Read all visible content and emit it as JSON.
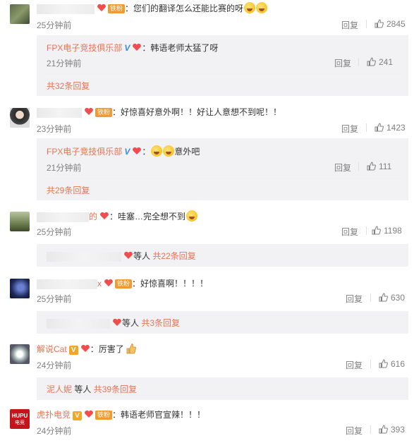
{
  "comments": [
    {
      "text": "：您们的翻译怎么还能比赛的呀",
      "badge": "铁粉",
      "time": "25分钟前",
      "reply_label": "回复",
      "likes": "2845",
      "sub_reply": {
        "name": "FPX电子竞技俱乐部",
        "text": "：韩语老师太猛了呀",
        "time": "21分钟前",
        "reply_label": "回复",
        "likes": "241"
      },
      "more": "共32条回复"
    },
    {
      "text": "：好惊喜好意外啊！！好让人意想不到呢！！",
      "badge": "铁粉",
      "time": "23分钟前",
      "reply_label": "回复",
      "likes": "1423",
      "sub_reply": {
        "name": "FPX电子竞技俱乐部",
        "text": "意外吧",
        "time": "21分钟前",
        "reply_label": "回复",
        "likes": "111"
      },
      "more": "共29条回复"
    },
    {
      "name_suffix": "的",
      "text": "：哇塞…完全想不到",
      "time": "25分钟前",
      "reply_label": "回复",
      "likes": "1198",
      "more_prefix": "等人",
      "more": "共22条回复"
    },
    {
      "name_suffix": "x",
      "badge": "铁粉",
      "text": "：好惊喜啊！！！！",
      "time": "25分钟前",
      "reply_label": "回复",
      "likes": "630",
      "more_prefix": "等人",
      "more": "共3条回复"
    },
    {
      "name": "解说Cat",
      "text": "：厉害了",
      "time": "24分钟前",
      "reply_label": "回复",
      "likes": "616",
      "more_name": "泥人妮",
      "more_prefix": "等人",
      "more": "共39条回复"
    },
    {
      "name": "虎扑电竞",
      "avatar_text": "HUPU",
      "avatar_sub": "电竞",
      "badge": "铁粉",
      "text": "：韩语老师官宣辣！！！",
      "time": "24分钟前",
      "reply_label": "回复",
      "likes": "393"
    }
  ],
  "colors": {
    "accent": "#eb7350",
    "link": "#eb7350",
    "muted": "#808080",
    "reply_bg": "#f2f2f5"
  }
}
